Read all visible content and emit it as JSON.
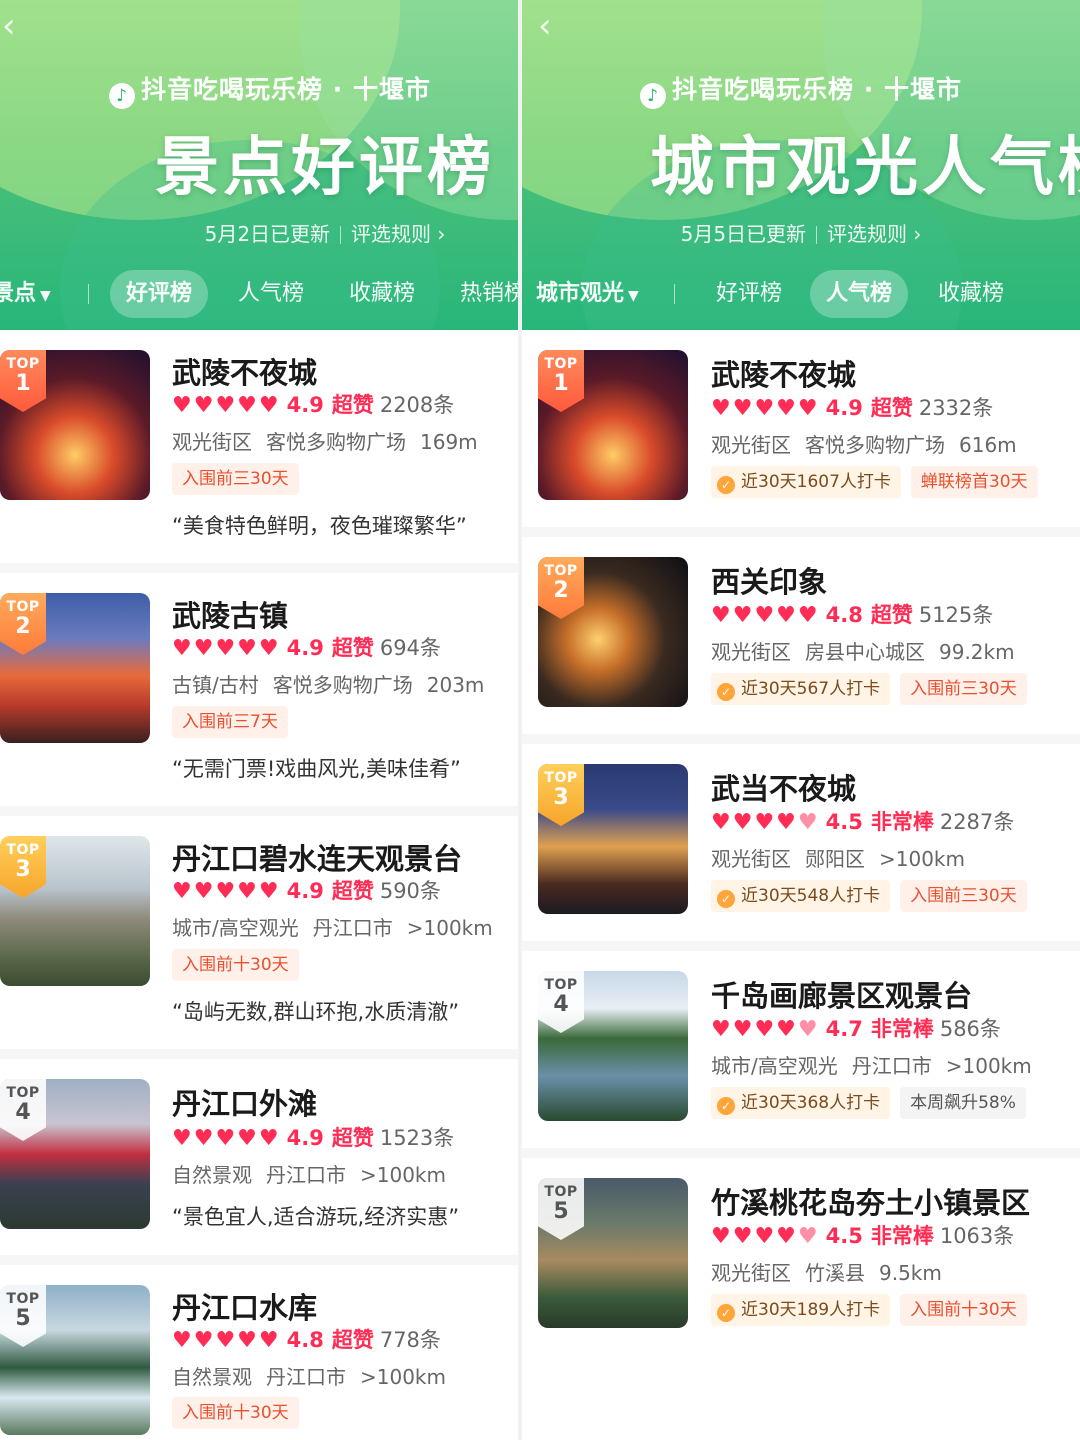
{
  "left": {
    "brand": "抖音吃喝玩乐榜 · 十堰市",
    "title": "景点好评榜",
    "updated": "5月2日已更新",
    "rule": "评选规则",
    "category": "景点",
    "tabs": [
      "好评榜",
      "人气榜",
      "收藏榜",
      "热销榜"
    ],
    "active_tab": "好评榜",
    "items": [
      {
        "rank": "1",
        "name": "武陵不夜城",
        "score": "4.9",
        "grade": "超赞",
        "count": "2208条",
        "type": "观光街区",
        "area": "客悦多购物广场",
        "distance": "169m",
        "badge": "入围前三30天",
        "quote": "“美食特色鲜明，夜色璀璨繁华”"
      },
      {
        "rank": "2",
        "name": "武陵古镇",
        "score": "4.9",
        "grade": "超赞",
        "count": "694条",
        "type": "古镇/古村",
        "area": "客悦多购物广场",
        "distance": "203m",
        "badge": "入围前三7天",
        "quote": "“无需门票!戏曲风光,美味佳肴”"
      },
      {
        "rank": "3",
        "name": "丹江口碧水连天观景台",
        "score": "4.9",
        "grade": "超赞",
        "count": "590条",
        "type": "城市/高空观光",
        "area": "丹江口市",
        "distance": ">100km",
        "badge": "入围前十30天",
        "quote": "“岛屿无数,群山环抱,水质清澈”"
      },
      {
        "rank": "4",
        "name": "丹江口外滩",
        "score": "4.9",
        "grade": "超赞",
        "count": "1523条",
        "type": "自然景观",
        "area": "丹江口市",
        "distance": ">100km",
        "badge": "",
        "quote": "“景色宜人,适合游玩,经济实惠”"
      },
      {
        "rank": "5",
        "name": "丹江口水库",
        "score": "4.8",
        "grade": "超赞",
        "count": "778条",
        "type": "自然景观",
        "area": "丹江口市",
        "distance": ">100km",
        "badge": "入围前十30天",
        "quote": ""
      }
    ]
  },
  "right": {
    "brand": "抖音吃喝玩乐榜 · 十堰市",
    "title": "城市观光人气榜",
    "updated": "5月5日已更新",
    "rule": "评选规则",
    "category": "城市观光",
    "tabs": [
      "好评榜",
      "人气榜",
      "收藏榜"
    ],
    "active_tab": "人气榜",
    "items": [
      {
        "rank": "1",
        "name": "武陵不夜城",
        "score": "4.9",
        "grade": "超赞",
        "count": "2332条",
        "type": "观光街区",
        "area": "客悦多购物广场",
        "distance": "616m",
        "checkin": "近30天1607人打卡",
        "badge": "蝉联榜首30天"
      },
      {
        "rank": "2",
        "name": "西关印象",
        "score": "4.8",
        "grade": "超赞",
        "count": "5125条",
        "type": "观光街区",
        "area": "房县中心城区",
        "distance": "99.2km",
        "checkin": "近30天567人打卡",
        "badge": "入围前三30天"
      },
      {
        "rank": "3",
        "name": "武当不夜城",
        "score": "4.5",
        "grade": "非常棒",
        "count": "2287条",
        "type": "观光街区",
        "area": "郧阳区",
        "distance": ">100km",
        "checkin": "近30天548人打卡",
        "badge": "入围前三30天"
      },
      {
        "rank": "4",
        "name": "千岛画廊景区观景台",
        "score": "4.7",
        "grade": "非常棒",
        "count": "586条",
        "type": "城市/高空观光",
        "area": "丹江口市",
        "distance": ">100km",
        "checkin": "近30天368人打卡",
        "badge": "本周飙升58%"
      },
      {
        "rank": "5",
        "name": "竹溪桃花岛夯土小镇景区",
        "score": "4.5",
        "grade": "非常棒",
        "count": "1063条",
        "type": "观光街区",
        "area": "竹溪县",
        "distance": "9.5km",
        "checkin": "近30天189人打卡",
        "badge": "入围前十30天"
      }
    ]
  },
  "icons": {
    "back": "chevron-left-icon",
    "logo": "douyin-logo-icon",
    "caret": "caret-down-icon",
    "rule_arrow": "chevron-right-icon",
    "checkin": "check-circle-icon"
  },
  "colors": {
    "header_green": "#27b67a",
    "heart_red": "#ff2d55",
    "badge_orange": "#e8502f"
  }
}
